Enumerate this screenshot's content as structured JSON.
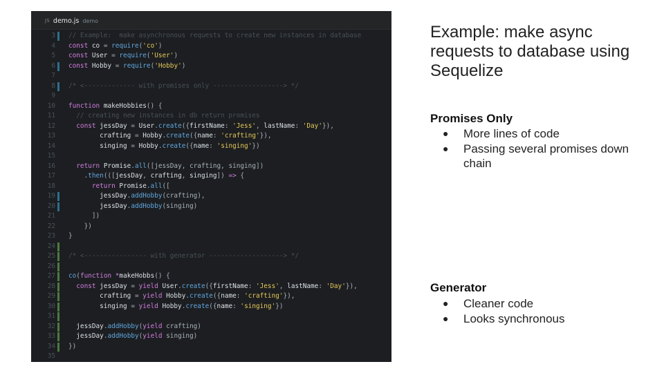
{
  "editor": {
    "tab": {
      "file_icon": "JS",
      "file_name": "demo.js",
      "project": "demo"
    },
    "lines": [
      {
        "n": "3",
        "mark": "mod",
        "t": [
          [
            "cm",
            "// Example:  make asynchronous requests to create new instances in database"
          ]
        ]
      },
      {
        "n": "4",
        "mark": "",
        "t": [
          [
            "kw",
            "const "
          ],
          [
            "id",
            "co "
          ],
          [
            "pl",
            "= "
          ],
          [
            "fn",
            "require"
          ],
          [
            "pl",
            "("
          ],
          [
            "str",
            "'co'"
          ],
          [
            "pl",
            ")"
          ]
        ]
      },
      {
        "n": "5",
        "mark": "",
        "t": [
          [
            "kw",
            "const "
          ],
          [
            "id",
            "User "
          ],
          [
            "pl",
            "= "
          ],
          [
            "fn",
            "require"
          ],
          [
            "pl",
            "("
          ],
          [
            "str",
            "'User'"
          ],
          [
            "pl",
            ")"
          ]
        ]
      },
      {
        "n": "6",
        "mark": "mod",
        "t": [
          [
            "kw",
            "const "
          ],
          [
            "id",
            "Hobby "
          ],
          [
            "pl",
            "= "
          ],
          [
            "fn",
            "require"
          ],
          [
            "pl",
            "("
          ],
          [
            "str",
            "'Hobby'"
          ],
          [
            "pl",
            ")"
          ]
        ]
      },
      {
        "n": "7",
        "mark": "",
        "t": []
      },
      {
        "n": "8",
        "mark": "mod",
        "t": [
          [
            "cm",
            "/* <------------- with promises only ------------------> */"
          ]
        ]
      },
      {
        "n": "9",
        "mark": "",
        "t": []
      },
      {
        "n": "10",
        "mark": "",
        "t": [
          [
            "kw",
            "function "
          ],
          [
            "id",
            "makeHobbies"
          ],
          [
            "pl",
            "() {"
          ]
        ]
      },
      {
        "n": "11",
        "mark": "",
        "t": [
          [
            "cm",
            "  // creating new instances in db return promises"
          ]
        ]
      },
      {
        "n": "12",
        "mark": "",
        "t": [
          [
            "kw",
            "  const "
          ],
          [
            "id",
            "jessDay "
          ],
          [
            "pl",
            "= "
          ],
          [
            "id",
            "User"
          ],
          [
            "pl",
            "."
          ],
          [
            "fn",
            "create"
          ],
          [
            "pl",
            "({"
          ],
          [
            "id",
            "firstName"
          ],
          [
            "pl",
            ": "
          ],
          [
            "str",
            "'Jess'"
          ],
          [
            "pl",
            ", "
          ],
          [
            "id",
            "lastName"
          ],
          [
            "pl",
            ": "
          ],
          [
            "str",
            "'Day'"
          ],
          [
            "pl",
            "}),"
          ]
        ]
      },
      {
        "n": "13",
        "mark": "",
        "t": [
          [
            "id",
            "        crafting "
          ],
          [
            "pl",
            "= "
          ],
          [
            "id",
            "Hobby"
          ],
          [
            "pl",
            "."
          ],
          [
            "fn",
            "create"
          ],
          [
            "pl",
            "({"
          ],
          [
            "id",
            "name"
          ],
          [
            "pl",
            ": "
          ],
          [
            "str",
            "'crafting'"
          ],
          [
            "pl",
            "}),"
          ]
        ]
      },
      {
        "n": "14",
        "mark": "",
        "t": [
          [
            "id",
            "        singing "
          ],
          [
            "pl",
            "= "
          ],
          [
            "id",
            "Hobby"
          ],
          [
            "pl",
            "."
          ],
          [
            "fn",
            "create"
          ],
          [
            "pl",
            "({"
          ],
          [
            "id",
            "name"
          ],
          [
            "pl",
            ": "
          ],
          [
            "str",
            "'singing'"
          ],
          [
            "pl",
            "})"
          ]
        ]
      },
      {
        "n": "15",
        "mark": "",
        "t": []
      },
      {
        "n": "16",
        "mark": "",
        "t": [
          [
            "kw",
            "  return "
          ],
          [
            "id",
            "Promise"
          ],
          [
            "pl",
            "."
          ],
          [
            "fn",
            "all"
          ],
          [
            "pl",
            "([jessDay, crafting, singing])"
          ]
        ]
      },
      {
        "n": "17",
        "mark": "",
        "t": [
          [
            "pl",
            "    ."
          ],
          [
            "fn",
            "then"
          ],
          [
            "pl",
            "((["
          ],
          [
            "id",
            "jessDay"
          ],
          [
            "pl",
            ", "
          ],
          [
            "id",
            "crafting"
          ],
          [
            "pl",
            ", "
          ],
          [
            "id",
            "singing"
          ],
          [
            "pl",
            "]) "
          ],
          [
            "kw",
            "=> "
          ],
          [
            "pl",
            "{"
          ]
        ]
      },
      {
        "n": "18",
        "mark": "",
        "t": [
          [
            "kw",
            "      return "
          ],
          [
            "id",
            "Promise"
          ],
          [
            "pl",
            "."
          ],
          [
            "fn",
            "all"
          ],
          [
            "pl",
            "(["
          ]
        ]
      },
      {
        "n": "19",
        "mark": "mod",
        "t": [
          [
            "id",
            "        jessDay"
          ],
          [
            "pl",
            "."
          ],
          [
            "fn",
            "addHobby"
          ],
          [
            "pl",
            "(crafting),"
          ]
        ]
      },
      {
        "n": "20",
        "mark": "mod",
        "t": [
          [
            "id",
            "        jessDay"
          ],
          [
            "pl",
            "."
          ],
          [
            "fn",
            "addHobby"
          ],
          [
            "pl",
            "(singing)"
          ]
        ]
      },
      {
        "n": "21",
        "mark": "",
        "t": [
          [
            "pl",
            "      ])"
          ]
        ]
      },
      {
        "n": "22",
        "mark": "",
        "t": [
          [
            "pl",
            "    })"
          ]
        ]
      },
      {
        "n": "23",
        "mark": "",
        "t": [
          [
            "pl",
            "}"
          ]
        ]
      },
      {
        "n": "24",
        "mark": "add",
        "t": []
      },
      {
        "n": "25",
        "mark": "add",
        "t": [
          [
            "cm",
            "/* <---------------- with generator -------------------> */"
          ]
        ]
      },
      {
        "n": "26",
        "mark": "add",
        "t": []
      },
      {
        "n": "27",
        "mark": "add",
        "t": [
          [
            "fn",
            "co"
          ],
          [
            "pl",
            "("
          ],
          [
            "kw",
            "function "
          ],
          [
            "kw",
            "*"
          ],
          [
            "id",
            "makeHobbs"
          ],
          [
            "pl",
            "() {"
          ]
        ]
      },
      {
        "n": "28",
        "mark": "add",
        "t": [
          [
            "kw",
            "  const "
          ],
          [
            "id",
            "jessDay "
          ],
          [
            "pl",
            "= "
          ],
          [
            "kw",
            "yield "
          ],
          [
            "id",
            "User"
          ],
          [
            "pl",
            "."
          ],
          [
            "fn",
            "create"
          ],
          [
            "pl",
            "({"
          ],
          [
            "id",
            "firstName"
          ],
          [
            "pl",
            ": "
          ],
          [
            "str",
            "'Jess'"
          ],
          [
            "pl",
            ", "
          ],
          [
            "id",
            "lastName"
          ],
          [
            "pl",
            ": "
          ],
          [
            "str",
            "'Day'"
          ],
          [
            "pl",
            "}),"
          ]
        ]
      },
      {
        "n": "29",
        "mark": "add",
        "t": [
          [
            "id",
            "        crafting "
          ],
          [
            "pl",
            "= "
          ],
          [
            "kw",
            "yield "
          ],
          [
            "id",
            "Hobby"
          ],
          [
            "pl",
            "."
          ],
          [
            "fn",
            "create"
          ],
          [
            "pl",
            "({"
          ],
          [
            "id",
            "name"
          ],
          [
            "pl",
            ": "
          ],
          [
            "str",
            "'crafting'"
          ],
          [
            "pl",
            "}),"
          ]
        ]
      },
      {
        "n": "30",
        "mark": "add",
        "t": [
          [
            "id",
            "        singing "
          ],
          [
            "pl",
            "= "
          ],
          [
            "kw",
            "yield "
          ],
          [
            "id",
            "Hobby"
          ],
          [
            "pl",
            "."
          ],
          [
            "fn",
            "create"
          ],
          [
            "pl",
            "({"
          ],
          [
            "id",
            "name"
          ],
          [
            "pl",
            ": "
          ],
          [
            "str",
            "'singing'"
          ],
          [
            "pl",
            "})"
          ]
        ]
      },
      {
        "n": "31",
        "mark": "add",
        "t": []
      },
      {
        "n": "32",
        "mark": "add",
        "t": [
          [
            "id",
            "  jessDay"
          ],
          [
            "pl",
            "."
          ],
          [
            "fn",
            "addHobby"
          ],
          [
            "pl",
            "("
          ],
          [
            "kw",
            "yield "
          ],
          [
            "pl",
            "crafting)"
          ]
        ]
      },
      {
        "n": "33",
        "mark": "add",
        "t": [
          [
            "id",
            "  jessDay"
          ],
          [
            "pl",
            "."
          ],
          [
            "fn",
            "addHobby"
          ],
          [
            "pl",
            "("
          ],
          [
            "kw",
            "yield "
          ],
          [
            "pl",
            "singing)"
          ]
        ]
      },
      {
        "n": "34",
        "mark": "add",
        "t": [
          [
            "pl",
            "})"
          ]
        ]
      },
      {
        "n": "35",
        "mark": "",
        "t": []
      }
    ]
  },
  "slide": {
    "title": "Example: make async requests to database using Sequelize",
    "sections": [
      {
        "heading": "Promises Only",
        "items": [
          "More lines of code",
          "Passing several promises down chain"
        ]
      },
      {
        "heading": "Generator",
        "items": [
          "Cleaner code",
          "Looks synchronous"
        ]
      }
    ],
    "bullet_char": "●"
  }
}
